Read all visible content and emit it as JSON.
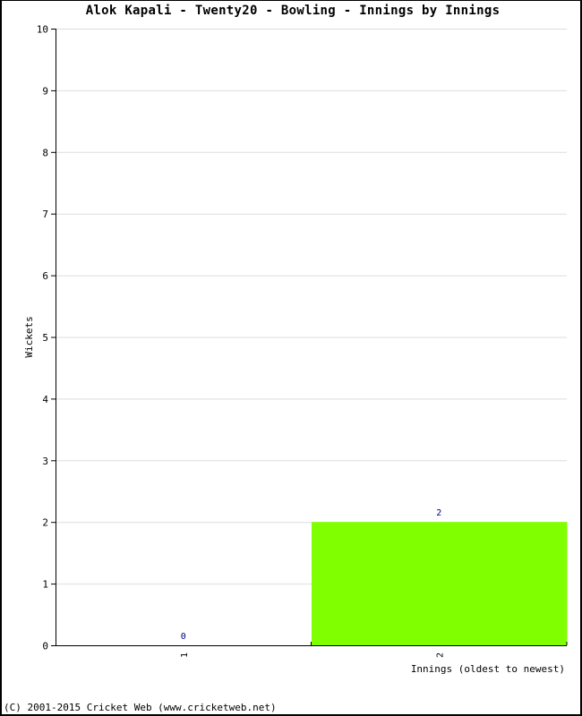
{
  "chart_data": {
    "type": "bar",
    "title": "Alok Kapali - Twenty20 - Bowling - Innings by Innings",
    "xlabel": "Innings (oldest to newest)",
    "ylabel": "Wickets",
    "categories": [
      "1",
      "2"
    ],
    "values": [
      0,
      2
    ],
    "data_labels": [
      "0",
      "2"
    ],
    "ylim": [
      0,
      10
    ],
    "yticks": [
      0,
      1,
      2,
      3,
      4,
      5,
      6,
      7,
      8,
      9,
      10
    ],
    "grid": true,
    "bar_color": "#80ff00",
    "label_color": "#000080",
    "grid_color": "#dddddd"
  },
  "footer": "(C) 2001-2015 Cricket Web (www.cricketweb.net)"
}
